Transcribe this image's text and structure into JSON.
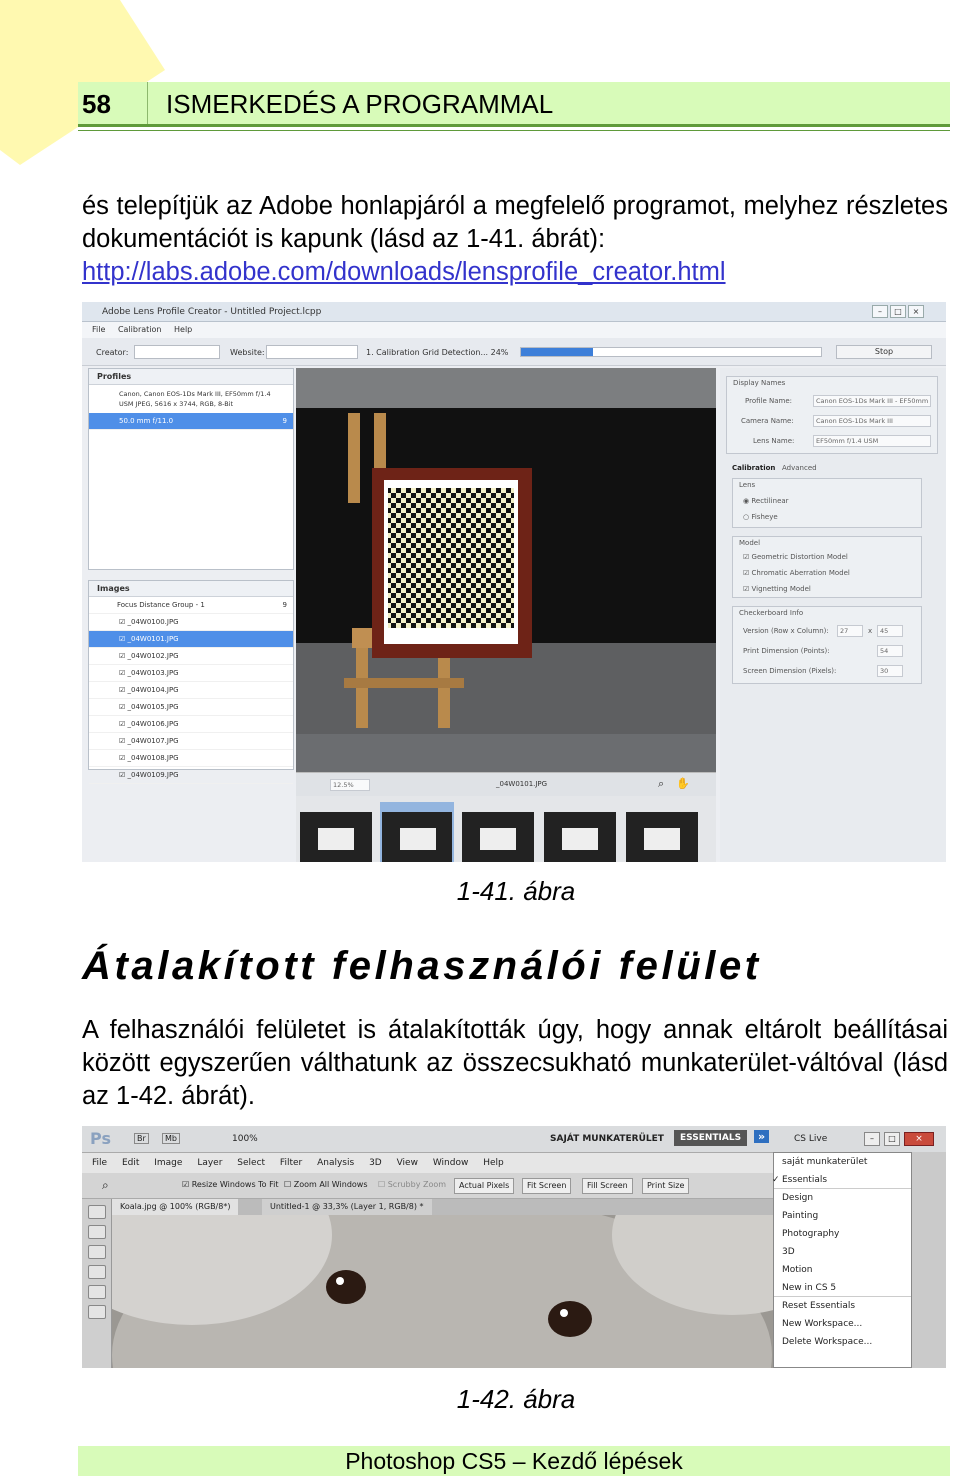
{
  "header": {
    "page_number": "58",
    "title": "ISMERKEDÉS A PROGRAMMAL"
  },
  "intro": {
    "text": "és telepítjük az Adobe honlapjáról a megfelelő programot, melyhez részletes dokumentációt is kapunk (lásd az 1-41. ábrát):",
    "link": "http://labs.adobe.com/downloads/lensprofile_creator.html"
  },
  "figure1": {
    "caption": "1-41. ábra",
    "window_title": "Adobe Lens Profile Creator - Untitled Project.lcpp",
    "menu": [
      "File",
      "Calibration",
      "Help"
    ],
    "creator_label": "Creator:",
    "website_label": "Website:",
    "progress_text": "1. Calibration Grid Detection... 24%",
    "progress": 0.24,
    "stop_label": "Stop",
    "profiles": {
      "title": "Profiles",
      "item": "Canon, Canon EOS-1Ds Mark III, EF50mm f/1.4 USM JPEG, 5616 x 3744, RGB, 8-Bit",
      "selected": "50.0 mm        f/11.0",
      "count": "9"
    },
    "images": {
      "title": "Images",
      "group": "Focus Distance Group - 1",
      "count": "9",
      "files": [
        "_04W0100.JPG",
        "_04W0101.JPG",
        "_04W0102.JPG",
        "_04W0103.JPG",
        "_04W0104.JPG",
        "_04W0105.JPG",
        "_04W0106.JPG",
        "_04W0107.JPG",
        "_04W0108.JPG",
        "_04W0109.JPG"
      ],
      "selected_file": "_04W0101.JPG"
    },
    "preview": {
      "zoom": "12.5%",
      "filename": "_04W0101.JPG"
    },
    "right_panel": {
      "display_names": "Display Names",
      "profile_name_label": "Profile Name:",
      "profile_name": "Canon EOS-1Ds Mark III - EF50mm",
      "camera_name_label": "Camera Name:",
      "camera_name": "Canon EOS-1Ds Mark III",
      "lens_name_label": "Lens Name:",
      "lens_name": "EF50mm f/1.4 USM",
      "tab_calibration": "Calibration",
      "tab_advanced": "Advanced",
      "lens": "Lens",
      "rectilinear": "Rectilinear",
      "fisheye": "Fisheye",
      "model": "Model",
      "geometric": "Geometric Distortion Model",
      "chromatic": "Chromatic Aberration Model",
      "vignetting": "Vignetting Model",
      "checkerboard": "Checkerboard Info",
      "version_label": "Version (Row x Column):",
      "rows": "27",
      "x": "x",
      "cols": "45",
      "print_label": "Print Dimension (Points):",
      "print_value": "54",
      "screen_label": "Screen Dimension (Pixels):",
      "screen_value": "30"
    }
  },
  "heading": "Átalakított felhasználói felület",
  "body2": "A felhasználói felületet is átalakították úgy, hogy annak eltárolt beállításai között egyszerűen válthatunk az összecsukható munkaterület-váltóval (lásd az 1-42. ábrát).",
  "figure2": {
    "caption": "1-42. ábra",
    "ps_logo": "Ps",
    "br": "Br",
    "mb": "Mb",
    "zoom": "100%",
    "workspace_label": "SAJÁT MUNKATERÜLET",
    "essentials": "ESSENTIALS",
    "cs_live": "CS Live",
    "menu": [
      "File",
      "Edit",
      "Image",
      "Layer",
      "Select",
      "Filter",
      "Analysis",
      "3D",
      "View",
      "Window",
      "Help"
    ],
    "options": [
      "Resize Windows To Fit",
      "Zoom All Windows",
      "Scrubby Zoom",
      "Actual Pixels",
      "Fit Screen",
      "Fill Screen",
      "Print Size"
    ],
    "tab1": "Koala.jpg @ 100% (RGB/8*)",
    "tab2": "Untitled-1 @ 33,3% (Layer 1, RGB/8) *",
    "workspaces": [
      "saját munkaterület",
      "Essentials",
      "Design",
      "Painting",
      "Photography",
      "3D",
      "Motion",
      "New in CS 5",
      "Reset Essentials",
      "New Workspace...",
      "Delete Workspace..."
    ]
  },
  "footer": "Photoshop CS5 – Kezdő lépések"
}
